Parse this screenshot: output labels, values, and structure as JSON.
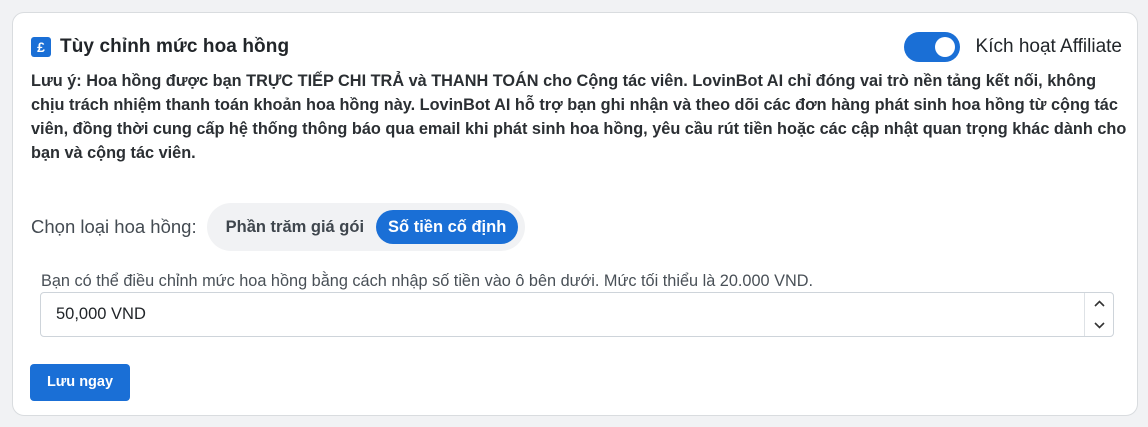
{
  "header": {
    "icon": "pound-currency-icon",
    "icon_glyph": "£",
    "title": "Tùy chỉnh mức hoa hồng",
    "toggle_on": true,
    "toggle_label": "Kích hoạt Affiliate"
  },
  "note": "Lưu ý: Hoa hồng được bạn TRỰC TIẾP CHI TRẢ và THANH TOÁN cho Cộng tác viên. LovinBot AI chỉ đóng vai trò nền tảng kết nối, không chịu trách nhiệm thanh toán khoản hoa hồng này. LovinBot AI hỗ trợ bạn ghi nhận và theo dõi các đơn hàng phát sinh hoa hồng từ cộng tác viên, đồng thời cung cấp hệ thống thông báo qua email khi phát sinh hoa hồng, yêu cầu rút tiền hoặc các cập nhật quan trọng khác dành cho bạn và cộng tác viên.",
  "commission_type": {
    "label": "Chọn loại hoa hồng:",
    "options": [
      "Phần trăm giá gói",
      "Số tiền cố định"
    ],
    "selected": "Số tiền cố định"
  },
  "amount": {
    "hint": "Bạn có thể điều chỉnh mức hoa hồng bằng cách nhập số tiền vào ô bên dưới. Mức tối thiểu là 20.000 VND.",
    "value": "50,000 VND"
  },
  "save_label": "Lưu ngay",
  "colors": {
    "primary": "#1a6fd6",
    "background": "#f1f2f4",
    "card": "#ffffff"
  }
}
